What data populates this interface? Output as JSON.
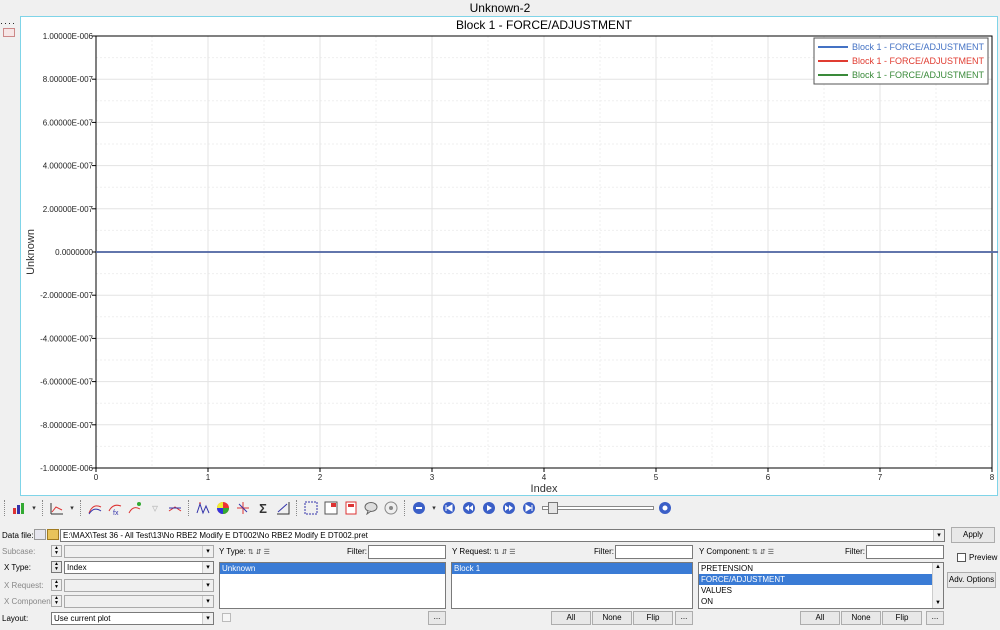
{
  "window": {
    "title": "Unknown-2"
  },
  "chart_data": {
    "type": "line",
    "title": "Block 1 - FORCE/ADJUSTMENT",
    "xlabel": "Index",
    "ylabel": "Unknown",
    "xlim": [
      0,
      8
    ],
    "ylim": [
      -1e-06,
      1e-06
    ],
    "x_ticks": [
      "0",
      "1",
      "2",
      "3",
      "4",
      "5",
      "6",
      "7",
      "8"
    ],
    "y_ticks": [
      "1.00000E-006",
      "8.00000E-007",
      "6.00000E-007",
      "4.00000E-007",
      "2.00000E-007",
      "0.0000000",
      "-2.00000E-007",
      "-4.00000E-007",
      "-6.00000E-007",
      "-8.00000E-007",
      "-1.00000E-006"
    ],
    "grid": true,
    "legend_position": "top-right",
    "series": [
      {
        "name": "Block 1 - FORCE/ADJUSTMENT",
        "color": "#4472c4",
        "x": [
          0,
          8
        ],
        "values": [
          0,
          0
        ]
      },
      {
        "name": "Block 1 - FORCE/ADJUSTMENT",
        "color": "#e03c31",
        "x": [
          0,
          8
        ],
        "values": [
          0,
          0
        ]
      },
      {
        "name": "Block 1 - FORCE/ADJUSTMENT",
        "color": "#3a8a3a",
        "x": [
          0,
          8
        ],
        "values": [
          0,
          0
        ]
      }
    ]
  },
  "toolbar": {
    "icons": [
      "build-plots-icon",
      "curve-type-icon",
      "add-curve-icon",
      "math-curve-icon",
      "edit-curve-icon",
      "filter-icon",
      "delete-curve-icon",
      "peak-icon",
      "color-wheel-icon",
      "axis-icon",
      "sigma-icon",
      "measure-icon",
      "window-layout-icon",
      "page-layout-icon",
      "report-icon",
      "note-icon",
      "options-icon",
      "animation-icon",
      "first-frame-icon",
      "prev-frame-icon",
      "play-icon",
      "next-frame-icon",
      "last-frame-icon",
      "settings-icon"
    ]
  },
  "panel": {
    "data_file_label": "Data file:",
    "data_file_path": "E:\\MAX\\Test 36 - All Test\\13\\No RBE2 Modify E DT002\\No RBE2 Modify E DT002.pret",
    "apply_label": "Apply",
    "subcase_label": "Subcase:",
    "x_type_label": "X Type:",
    "x_type_value": "Index",
    "x_request_label": "X Request:",
    "x_component_label": "X Component:",
    "layout_label": "Layout:",
    "layout_value": "Use current plot",
    "y_type_label": "Y Type:",
    "y_type_filter_label": "Filter:",
    "y_type_items": [
      "Unknown"
    ],
    "y_request_label": "Y Request:",
    "y_request_filter_label": "Filter:",
    "y_request_items": [
      "Block 1"
    ],
    "y_component_label": "Y Component:",
    "y_component_filter_label": "Filter:",
    "y_component_items": [
      "PRETENSION",
      "FORCE/ADJUSTMENT",
      "VALUES",
      "ON"
    ],
    "preview_label": "Preview",
    "adv_options_label": "Adv. Options",
    "all_label": "All",
    "none_label": "None",
    "flip_label": "Flip",
    "more_label": "..."
  }
}
